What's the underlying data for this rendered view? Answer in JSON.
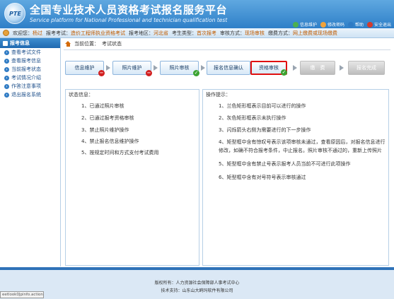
{
  "header": {
    "title": "全国专业技术人员资格考试报名服务平台",
    "subtitle": "Service platform for National Professional and technician qualification test",
    "logo_text": "PTE",
    "links": [
      {
        "label": "信息维护",
        "color": "#4caf50"
      },
      {
        "label": "修改密码",
        "color": "#f1a33b"
      },
      {
        "label": "帮助",
        "color": "#2f7bc4"
      },
      {
        "label": "安全退出",
        "color": "#d33b2c"
      }
    ]
  },
  "infobar": {
    "items": [
      {
        "key": "欢迎您：",
        "value": "杨过"
      },
      {
        "key": "报考考试：",
        "value": "造价工程师执业资格考试"
      },
      {
        "key": "报考地区：",
        "value": "河北省"
      },
      {
        "key": "考生类型：",
        "value": "首次报考"
      },
      {
        "key": "审核方式：",
        "value": "现场审核"
      },
      {
        "key": "缴费方式：",
        "value": "网上缴费或现场缴费"
      }
    ]
  },
  "sidebar": {
    "title": "报考信息",
    "items": [
      {
        "label": "查看考试文件"
      },
      {
        "label": "查看报考信息"
      },
      {
        "label": "当前报考状态"
      },
      {
        "label": "考试情况介绍"
      },
      {
        "label": "作答注意事项"
      },
      {
        "label": "退出报名系统"
      }
    ]
  },
  "breadcrumb": {
    "prefix": "当前位置：",
    "current": "考试状态"
  },
  "steps": [
    {
      "label": "信息维护",
      "state": "done",
      "badge": "−",
      "badge_color": "red"
    },
    {
      "label": "照片维护",
      "state": "done",
      "badge": "−",
      "badge_color": "red"
    },
    {
      "label": "照片审核",
      "state": "done",
      "badge": "✓",
      "badge_color": "green"
    },
    {
      "label": "报名信息确认",
      "state": "done",
      "badge": "",
      "badge_color": ""
    },
    {
      "label": "资格审核",
      "state": "current",
      "badge": "✓",
      "badge_color": "green"
    },
    {
      "label": "缴　费",
      "state": "gray",
      "badge": "",
      "badge_color": ""
    },
    {
      "label": "报名完成",
      "state": "gray",
      "badge": "",
      "badge_color": ""
    }
  ],
  "status_panel": {
    "title": "状态信息：",
    "lines": [
      "1、已通过照片审核",
      "2、已通过报考资格审核",
      "3、禁止照片维护操作",
      "4、禁止报名信息维护操作",
      "5、按规定时间和方式支付考试费用"
    ]
  },
  "tips_panel": {
    "title": "操作提示：",
    "lines": [
      "1、兰色矩形框表示目前可以进行的操作",
      "2、灰色矩形框表示未执行操作",
      "3、闪烁箭头右侧为需要进行的下一步操作",
      "4、矩型框中含有惊叹号表示该项审核未通过，查看原因后，对报名信息进行修改，如确不符合报考条件，中止报名。照片审核不通过的，重新上传照片",
      "5、矩型框中含有禁止号表示报考人员当前不可进行此项操作",
      "6、矩型框中含有对号符号表示审核通过"
    ]
  },
  "footer": {
    "line1": "版权所有：人力资源社会保障部人事考试中心",
    "line2": "技术支持：山东山大鸥玛软件有限公司",
    "status_text": "eetlook0Jpinfo.action"
  }
}
